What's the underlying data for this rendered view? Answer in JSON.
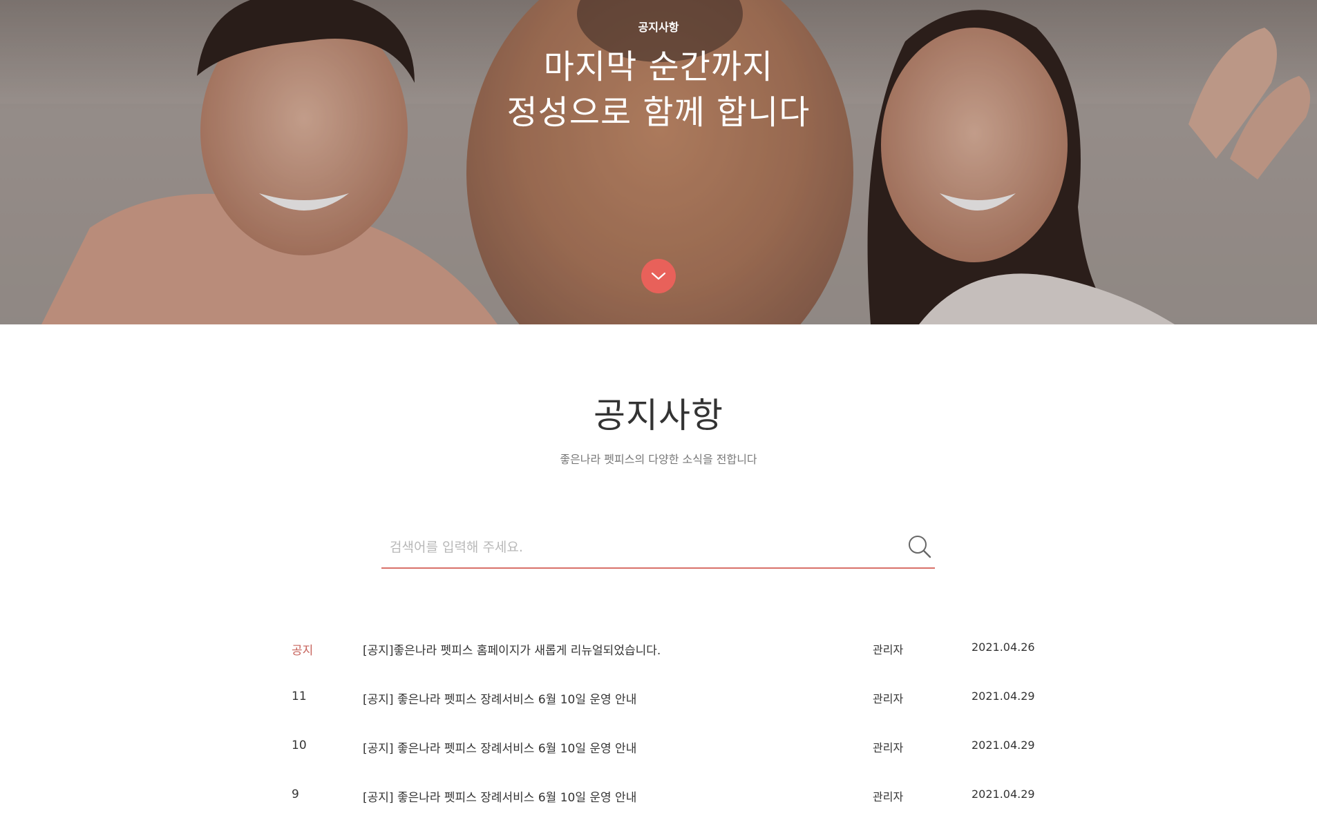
{
  "hero": {
    "eyebrow": "공지사항",
    "title_line1": "마지막 순간까지",
    "title_line2": "정성으로 함께 합니다",
    "scroll_icon": "chevron-down-icon",
    "accent_color": "#e8615a"
  },
  "section": {
    "title": "공지사항",
    "subtitle": "좋은나라 펫피스의 다양한 소식을 전합니다"
  },
  "search": {
    "placeholder": "검색어를 입력해 주세요.",
    "value": "",
    "icon": "search-icon",
    "underline_color": "#d87068"
  },
  "notices": [
    {
      "num": "공지",
      "title": "[공지]좋은나라 펫피스 홈페이지가 새롭게 리뉴얼되었습니다.",
      "author": "관리자",
      "date": "2021.04.26"
    },
    {
      "num": "11",
      "title": "[공지] 좋은나라 펫피스 장례서비스 6월 10일 운영 안내",
      "author": "관리자",
      "date": "2021.04.29"
    },
    {
      "num": "10",
      "title": "[공지] 좋은나라 펫피스 장례서비스 6월 10일 운영 안내",
      "author": "관리자",
      "date": "2021.04.29"
    },
    {
      "num": "9",
      "title": "[공지] 좋은나라 펫피스 장례서비스 6월 10일 운영 안내",
      "author": "관리자",
      "date": "2021.04.29"
    }
  ]
}
